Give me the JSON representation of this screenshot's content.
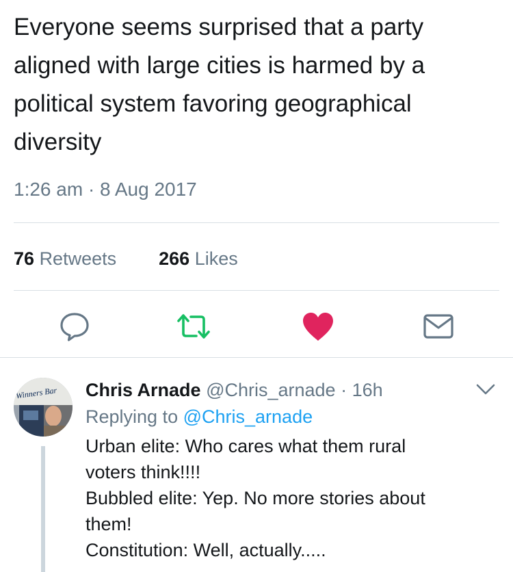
{
  "tweet": {
    "text": "Everyone seems surprised that a party aligned with large cities is harmed by a political system favoring geographical diversity",
    "timestamp": "1:26 am · 8 Aug 2017"
  },
  "stats": {
    "retweets_count": "76",
    "retweets_label": "Retweets",
    "likes_count": "266",
    "likes_label": "Likes"
  },
  "actions": {
    "reply_icon": "speech-bubble-icon",
    "retweet_icon": "retweet-icon",
    "like_icon": "heart-icon",
    "dm_icon": "envelope-icon"
  },
  "colors": {
    "retweet_active": "#17bf63",
    "like_active": "#e0245e",
    "link": "#1da1f2",
    "secondary_text": "#657786"
  },
  "reply": {
    "avatar_sign": "Winners Bar",
    "name": "Chris Arnade",
    "handle": "@Chris_arnade",
    "separator": "·",
    "time": "16h",
    "replying_prefix": "Replying to",
    "replying_to": "@Chris_arnade",
    "lines": [
      "Urban elite: Who cares what them rural",
      "voters think!!!!",
      "Bubbled elite: Yep. No more stories about",
      "them!",
      "Constitution: Well, actually....."
    ]
  }
}
